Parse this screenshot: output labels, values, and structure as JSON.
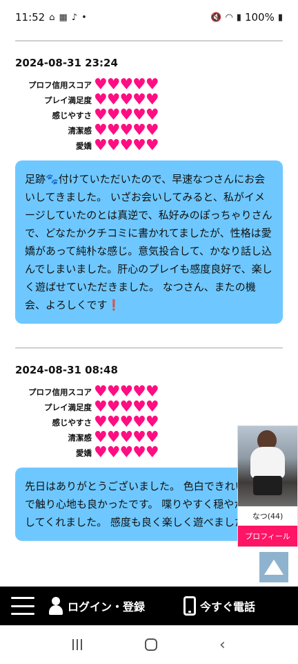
{
  "status_bar": {
    "time": "11:52",
    "battery": "100%",
    "left_icons": [
      "home-icon",
      "calendar-icon",
      "tiktok-icon",
      "dot-icon"
    ],
    "right_icons": [
      "mute-icon",
      "wifi-icon",
      "signal-icon",
      "battery-icon"
    ]
  },
  "rating_labels": [
    "プロフ信用スコア",
    "プレイ満足度",
    "感じやすさ",
    "清潔感",
    "愛嬌"
  ],
  "reviews": [
    {
      "date": "2024-08-31 23:24",
      "ratings": [
        5,
        5,
        5,
        5,
        5
      ],
      "text": "足跡🐾付けていただいたので、早速なつさんにお会いしてきました。 いざお会いしてみると、私がイメージしていたのとは真逆で、私好みのぽっちゃりさんで、どなたかクチコミに書かれてましたが、性格は愛嬌があって純朴な感じ。意気投合して、かなり話し込んでしまいました。肝心のプレイも感度良好で、楽しく遊ばせていただきました。 なつさん、またの機会、よろしくです❗️"
    },
    {
      "date": "2024-08-31 08:48",
      "ratings": [
        5,
        5,
        5,
        5,
        5
      ],
      "text": "先日はありがとうございました。 色白できれいな肌で触り心地も良かったです。 喋りやすく穏やかに接してくれました。 感度も良く楽しく遊べました。"
    }
  ],
  "side_card": {
    "name": "なつ(44)",
    "button": "プロフィール"
  },
  "bottom_nav": {
    "login_label": "ログイン・登録",
    "call_label": "今すぐ電話"
  },
  "colors": {
    "heart": "#ff0d82",
    "bubble": "#6ec8ff",
    "profile_button": "#ff1466",
    "nav_bg": "#000000"
  }
}
